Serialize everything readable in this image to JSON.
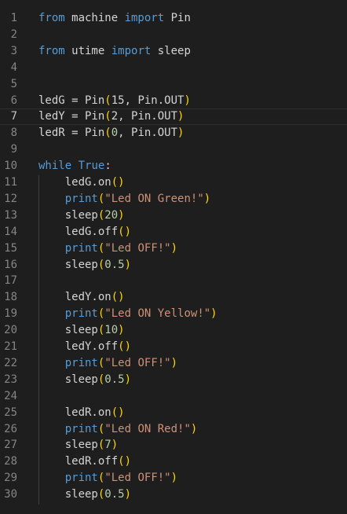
{
  "editor": {
    "lines": [
      {
        "n": "1",
        "tokens": [
          [
            "kw",
            "from"
          ],
          [
            "id",
            " machine "
          ],
          [
            "kw",
            "import"
          ],
          [
            "id",
            " Pin"
          ]
        ]
      },
      {
        "n": "2",
        "tokens": []
      },
      {
        "n": "3",
        "tokens": [
          [
            "kw",
            "from"
          ],
          [
            "id",
            " utime "
          ],
          [
            "kw",
            "import"
          ],
          [
            "id",
            " sleep"
          ]
        ]
      },
      {
        "n": "4",
        "tokens": []
      },
      {
        "n": "5",
        "tokens": []
      },
      {
        "n": "6",
        "tokens": [
          [
            "id",
            "ledG = Pin"
          ],
          [
            "p1",
            "("
          ],
          [
            "id",
            "15, Pin.OUT"
          ],
          [
            "p1",
            ")"
          ]
        ]
      },
      {
        "n": "7",
        "tokens": [
          [
            "id",
            "ledY = Pin"
          ],
          [
            "p1",
            "("
          ],
          [
            "id",
            "2, Pin.OUT"
          ],
          [
            "p1",
            ")"
          ]
        ],
        "current": true
      },
      {
        "n": "8",
        "tokens": [
          [
            "id",
            "ledR = Pin"
          ],
          [
            "p1",
            "("
          ],
          [
            "num",
            "0"
          ],
          [
            "id",
            ", Pin.OUT"
          ],
          [
            "p1",
            ")"
          ]
        ]
      },
      {
        "n": "9",
        "tokens": []
      },
      {
        "n": "10",
        "tokens": [
          [
            "kw",
            "while"
          ],
          [
            "id",
            " "
          ],
          [
            "kw",
            "True"
          ],
          [
            "id",
            ":"
          ]
        ]
      },
      {
        "n": "11",
        "tokens": [
          [
            "id",
            "    ledG.on"
          ],
          [
            "p1",
            "()"
          ]
        ]
      },
      {
        "n": "12",
        "tokens": [
          [
            "id",
            "    "
          ],
          [
            "kw",
            "print"
          ],
          [
            "p1",
            "("
          ],
          [
            "str",
            "\"Led ON Green!\""
          ],
          [
            "p1",
            ")"
          ]
        ]
      },
      {
        "n": "13",
        "tokens": [
          [
            "id",
            "    sleep"
          ],
          [
            "p1",
            "("
          ],
          [
            "num",
            "20"
          ],
          [
            "p1",
            ")"
          ]
        ]
      },
      {
        "n": "14",
        "tokens": [
          [
            "id",
            "    ledG.off"
          ],
          [
            "p1",
            "()"
          ]
        ]
      },
      {
        "n": "15",
        "tokens": [
          [
            "id",
            "    "
          ],
          [
            "kw",
            "print"
          ],
          [
            "p1",
            "("
          ],
          [
            "str",
            "\"Led OFF!\""
          ],
          [
            "p1",
            ")"
          ]
        ]
      },
      {
        "n": "16",
        "tokens": [
          [
            "id",
            "    sleep"
          ],
          [
            "p1",
            "("
          ],
          [
            "num",
            "0.5"
          ],
          [
            "p1",
            ")"
          ]
        ]
      },
      {
        "n": "17",
        "tokens": []
      },
      {
        "n": "18",
        "tokens": [
          [
            "id",
            "    ledY.on"
          ],
          [
            "p1",
            "()"
          ]
        ]
      },
      {
        "n": "19",
        "tokens": [
          [
            "id",
            "    "
          ],
          [
            "kw",
            "print"
          ],
          [
            "p1",
            "("
          ],
          [
            "str",
            "\"Led ON Yellow!\""
          ],
          [
            "p1",
            ")"
          ]
        ]
      },
      {
        "n": "20",
        "tokens": [
          [
            "id",
            "    sleep"
          ],
          [
            "p1",
            "("
          ],
          [
            "num",
            "10"
          ],
          [
            "p1",
            ")"
          ]
        ]
      },
      {
        "n": "21",
        "tokens": [
          [
            "id",
            "    ledY.off"
          ],
          [
            "p1",
            "()"
          ]
        ]
      },
      {
        "n": "22",
        "tokens": [
          [
            "id",
            "    "
          ],
          [
            "kw",
            "print"
          ],
          [
            "p1",
            "("
          ],
          [
            "str",
            "\"Led OFF!\""
          ],
          [
            "p1",
            ")"
          ]
        ]
      },
      {
        "n": "23",
        "tokens": [
          [
            "id",
            "    sleep"
          ],
          [
            "p1",
            "("
          ],
          [
            "num",
            "0.5"
          ],
          [
            "p1",
            ")"
          ]
        ]
      },
      {
        "n": "24",
        "tokens": []
      },
      {
        "n": "25",
        "tokens": [
          [
            "id",
            "    ledR.on"
          ],
          [
            "p1",
            "()"
          ]
        ]
      },
      {
        "n": "26",
        "tokens": [
          [
            "id",
            "    "
          ],
          [
            "kw",
            "print"
          ],
          [
            "p1",
            "("
          ],
          [
            "str",
            "\"Led ON Red!\""
          ],
          [
            "p1",
            ")"
          ]
        ]
      },
      {
        "n": "27",
        "tokens": [
          [
            "id",
            "    sleep"
          ],
          [
            "p1",
            "("
          ],
          [
            "num",
            "7"
          ],
          [
            "p1",
            ")"
          ]
        ]
      },
      {
        "n": "28",
        "tokens": [
          [
            "id",
            "    ledR.off"
          ],
          [
            "p1",
            "()"
          ]
        ]
      },
      {
        "n": "29",
        "tokens": [
          [
            "id",
            "    "
          ],
          [
            "kw",
            "print"
          ],
          [
            "p1",
            "("
          ],
          [
            "str",
            "\"Led OFF!\""
          ],
          [
            "p1",
            ")"
          ]
        ]
      },
      {
        "n": "30",
        "tokens": [
          [
            "id",
            "    sleep"
          ],
          [
            "p1",
            "("
          ],
          [
            "num",
            "0.5"
          ],
          [
            "p1",
            ")"
          ]
        ]
      }
    ]
  },
  "colors": {
    "background": "#1e1e1e",
    "line_number": "#858585",
    "keyword": "#569cd6",
    "string": "#ce9178",
    "number": "#b5cea8",
    "bracket": "#ffd700",
    "text": "#d4d4d4"
  }
}
